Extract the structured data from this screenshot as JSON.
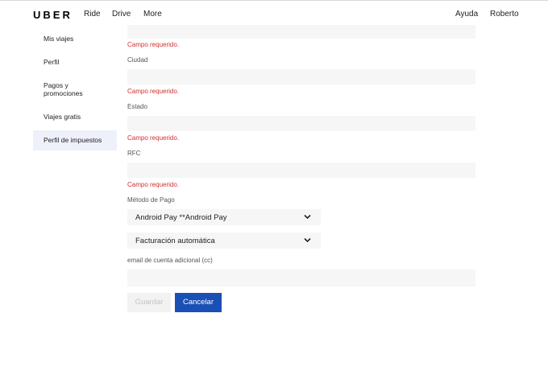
{
  "header": {
    "logo": "UBER",
    "nav": [
      "Ride",
      "Drive",
      "More"
    ],
    "help": "Ayuda",
    "user": "Roberto"
  },
  "sidebar": {
    "items": [
      {
        "label": "Mis viajes"
      },
      {
        "label": "Perfil"
      },
      {
        "label": "Pagos y promociones"
      },
      {
        "label": "Viajes gratis"
      },
      {
        "label": "Perfil de impuestos",
        "active": true
      }
    ]
  },
  "form": {
    "error_text": "Campo requerido.",
    "labels": {
      "city": "Ciudad",
      "state": "Estado",
      "rfc": "RFC",
      "payment_method": "Método de Pago",
      "cc_email": "email de cuenta adicional (cc)"
    },
    "values": {
      "previous_field": "",
      "city": "",
      "state": "",
      "rfc": "",
      "cc_email": ""
    },
    "selects": {
      "payment_method": "Android Pay **Android Pay",
      "billing": "Facturación automática"
    },
    "buttons": {
      "save": "Guardar",
      "cancel": "Cancelar"
    }
  },
  "colors": {
    "error": "#d32f2f",
    "primary_button": "#1a50b5",
    "active_sidebar_bg": "#eef1fa",
    "field_bg": "#f6f6f6"
  }
}
